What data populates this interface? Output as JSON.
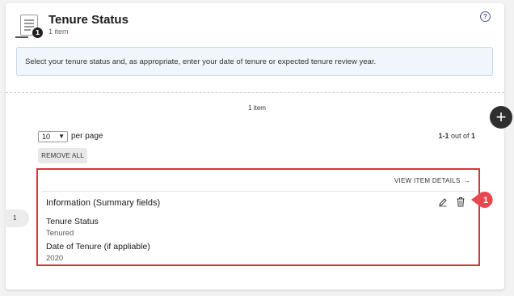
{
  "header": {
    "title": "Tenure Status",
    "subtitle": "1 item",
    "doc_badge": "1",
    "help_symbol": "?"
  },
  "info": {
    "message": "Select your tenure status and, as appropriate, enter your date of tenure or expected tenure review year."
  },
  "list": {
    "count_label": "1 item",
    "add_symbol": "+",
    "per_page_value": "10",
    "per_page_label": "per page",
    "range_prefix": "1-1",
    "range_middle": " out of ",
    "range_total": "1",
    "remove_all_label": "REMOVE ALL",
    "row_number": "1"
  },
  "item": {
    "view_details_label": "VIEW ITEM DETAILS",
    "view_details_arrow": "→",
    "summary_title": "Information (Summary fields)",
    "fields": [
      {
        "label": "Tenure Status",
        "value": "Tenured"
      },
      {
        "label": "Date of Tenure (if appliable)",
        "value": "2020"
      }
    ]
  },
  "callout": {
    "number": "1",
    "color": "#e8474f"
  },
  "colors": {
    "highlight": "#d9333f",
    "info_bg": "#f0f6fc",
    "info_border": "#c6d9ec",
    "add_button": "#2f2f2f"
  }
}
